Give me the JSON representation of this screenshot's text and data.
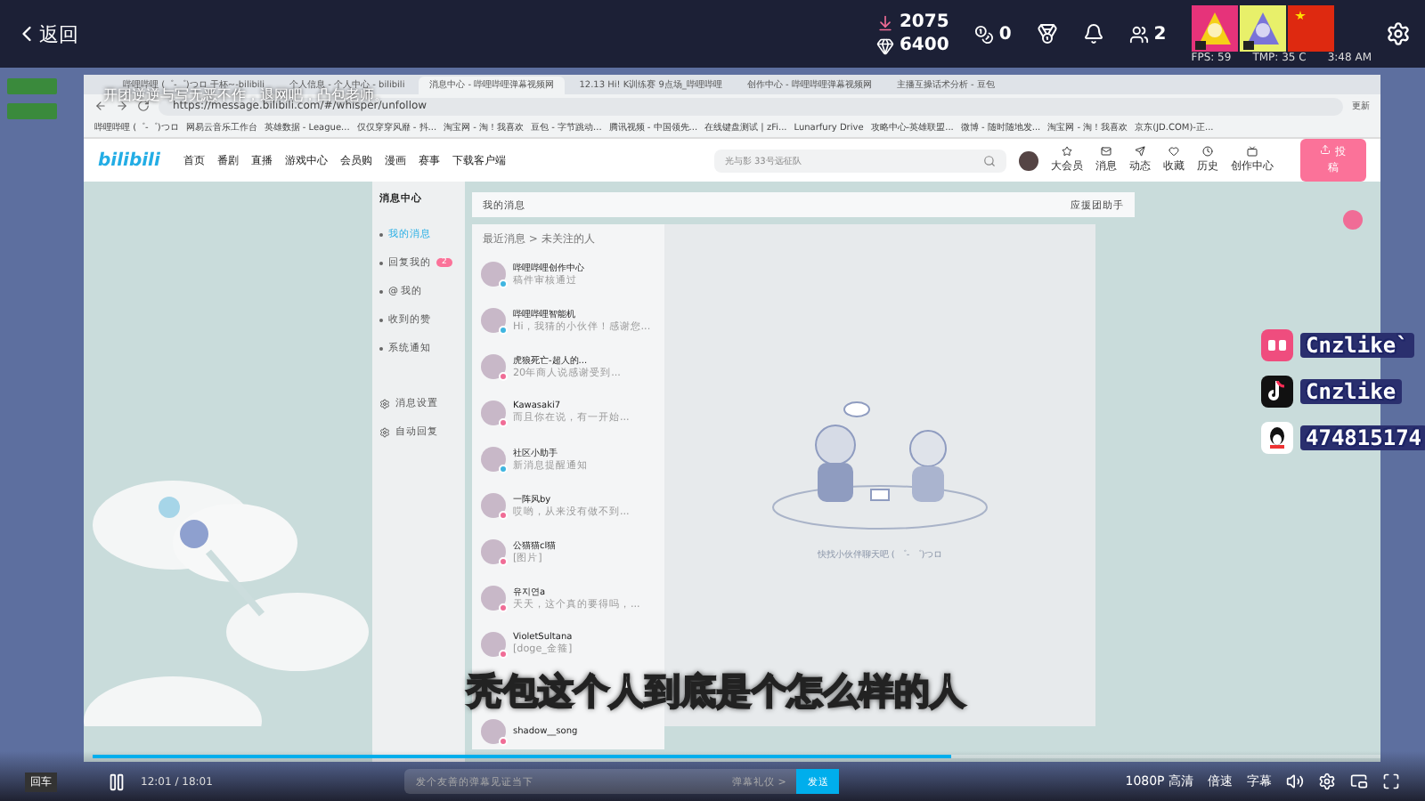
{
  "topbar": {
    "back": "返回",
    "stats": [
      {
        "kind": "down",
        "value": "2075"
      },
      {
        "kind": "diamond",
        "value": "6400"
      }
    ],
    "coins": "0",
    "fans": "2",
    "fps": "FPS: 59",
    "temp": "TMP: 35 C",
    "clock": "3:48 AM"
  },
  "danmaku": "开团逆逆与写无恶不作，退网吧，凸包老师。",
  "browser": {
    "tabs": [
      {
        "label": "哔哩哔哩 (゜-゜)つロ 干杯~-bilibili",
        "selected": false
      },
      {
        "label": "个人信息 - 个人中心 - bilibili",
        "selected": false
      },
      {
        "label": "消息中心 - 哔哩哔哩弹幕视频网",
        "selected": true
      },
      {
        "label": "12.13 Hi! K训练赛 9点场_哔哩哔哩",
        "selected": false
      },
      {
        "label": "创作中心 - 哔哩哔哩弹幕视频网",
        "selected": false
      },
      {
        "label": "主播互操话术分析 - 豆包",
        "selected": false
      }
    ],
    "url": "https://message.bilibili.com/#/whisper/unfollow",
    "update": "更新",
    "bookmarks": [
      "哔哩哔哩 (゜-゜)つロ",
      "网易云音乐工作台",
      "英雄数据 - League...",
      "仅仅穿穿风靡 - 抖...",
      "淘宝网 - 淘！我喜欢",
      "豆包 - 字节跳动...",
      "腾讯视频 - 中国领先...",
      "在线键盘测试 | zFi...",
      "Lunarfury Drive",
      "攻略中心-英雄联盟...",
      "微博 - 随时随地发...",
      "淘宝网 - 淘！我喜欢",
      "京东(JD.COM)-正..."
    ]
  },
  "site": {
    "logo": "bilibili",
    "nav": [
      "首页",
      "番剧",
      "直播",
      "游戏中心",
      "会员购",
      "漫画",
      "赛事",
      "下载客户端"
    ],
    "search_placeholder": "光与影 33号远征队",
    "user_links": [
      "大会员",
      "消息",
      "动态",
      "收藏",
      "历史",
      "创作中心"
    ],
    "upload": "投稿"
  },
  "message_center": {
    "title": "消息中心",
    "items": [
      {
        "label": "我的消息",
        "selected": true
      },
      {
        "label": "回复我的",
        "selected": false,
        "badge": "2"
      },
      {
        "label": "@ 我的",
        "selected": false
      },
      {
        "label": "收到的赞",
        "selected": false
      },
      {
        "label": "系统通知",
        "selected": false
      }
    ],
    "settings": [
      "消息设置",
      "自动回复"
    ],
    "panel_title": "我的消息",
    "helper": "应援团助手",
    "breadcrumb": "最近消息 > 未关注的人",
    "conversations": [
      {
        "name": "哔哩哔哩创作中心",
        "preview": "稿件审核通过",
        "color": "#3fb5e0"
      },
      {
        "name": "哔哩哔哩智能机",
        "preview": "Hi，我猜的小伙伴！感谢您...",
        "color": "#3fb5e0"
      },
      {
        "name": "虎狼死亡-超人的...",
        "preview": "20年商人说感谢受到...",
        "color": "#f06c96"
      },
      {
        "name": "Kawasaki7",
        "preview": "而且你在说，有一开始...",
        "color": "#f06c96"
      },
      {
        "name": "社区小助手",
        "preview": "新消息提醒通知",
        "color": "#3fb5e0"
      },
      {
        "name": "一阵风by",
        "preview": "哎哟，从来没有做不到...",
        "color": "#f06c96"
      },
      {
        "name": "公猫猫cl猫",
        "preview": "[图片]",
        "color": "#f06c96"
      },
      {
        "name": "유지연a",
        "preview": "天天，这个真的要得吗，...",
        "color": "#f06c96"
      },
      {
        "name": "VioletSultana",
        "preview": "[doge_金箍]",
        "color": "#f06c96"
      },
      {
        "name": "shadow__song",
        "color": "#f06c96"
      }
    ],
    "empty_text": "快找小伙伴聊天吧 ( ゜- ゜)つロ"
  },
  "subtitle": "秃包这个人到底是个怎么样的人",
  "socials": [
    {
      "kind": "lofter",
      "handle": "Cnzlike`"
    },
    {
      "kind": "tiktok",
      "handle": "Cnzlike"
    },
    {
      "kind": "qq",
      "handle": "474815174"
    }
  ],
  "player": {
    "left_label": "回车",
    "time": "12:01 / 18:01",
    "level": 0.667,
    "danmaku_placeholder": "发个友善的弹幕见证当下",
    "etiquette": "弹幕礼仪 >",
    "send": "发送",
    "quality": "1080P 高清",
    "speed": "倍速",
    "subtitles": "字幕"
  }
}
